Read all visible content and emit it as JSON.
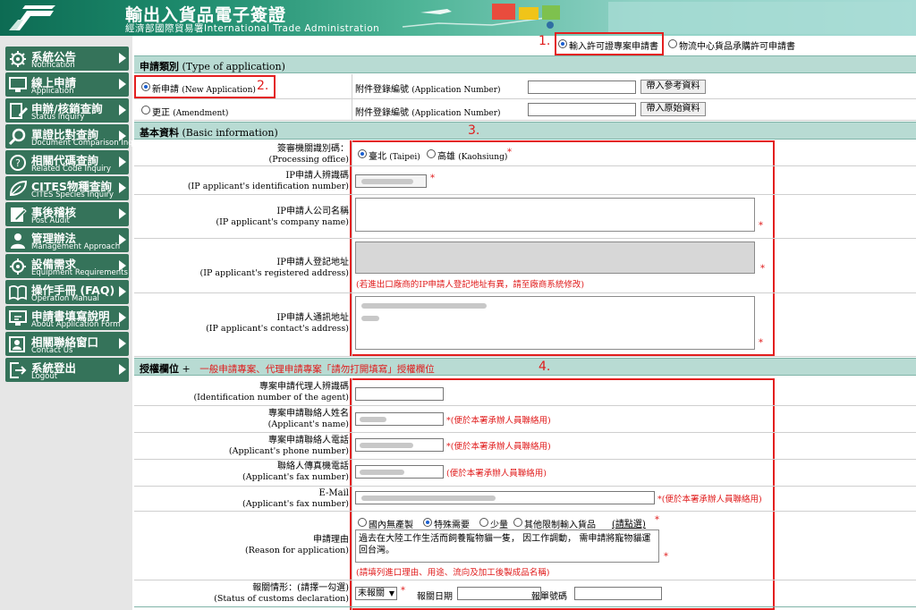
{
  "header": {
    "title": "輸出入貨品電子簽證",
    "agency": "經濟部國際貿易署International Trade Administration"
  },
  "sidebar": {
    "items": [
      {
        "zh": "系統公告",
        "en": "Notification",
        "icon": "settings-gear-icon"
      },
      {
        "zh": "線上申請",
        "en": "Application",
        "icon": "monitor-icon"
      },
      {
        "zh": "申辦/核銷查詢",
        "en": "Status Inquiry",
        "icon": "edit-document-icon"
      },
      {
        "zh": "單證比對查詢",
        "en": "Document Comparison Inquiry",
        "icon": "magnifier-icon"
      },
      {
        "zh": "相關代碼查詢",
        "en": "Related Code Inquiry",
        "icon": "question-icon"
      },
      {
        "zh": "CITES物種查詢",
        "en": "CITES Species Inquiry",
        "icon": "leaf-icon"
      },
      {
        "zh": "事後稽核",
        "en": "Post Audit",
        "icon": "pencil-icon"
      },
      {
        "zh": "管理辦法",
        "en": "Management Approach",
        "icon": "person-icon"
      },
      {
        "zh": "設備需求",
        "en": "Equipment Requirements",
        "icon": "settings-gear-icon"
      },
      {
        "zh": "操作手冊 (FAQ)",
        "en": "Operation Manual",
        "icon": "book-icon"
      },
      {
        "zh": "申請書填寫說明",
        "en": "About Application Form",
        "icon": "monitor-icon"
      },
      {
        "zh": "相關聯絡窗口",
        "en": "Contact Us",
        "icon": "contacts-icon"
      },
      {
        "zh": "系統登出",
        "en": "Logout",
        "icon": "logout-icon"
      }
    ]
  },
  "annotations": {
    "a1": "1.",
    "a2": "2.",
    "a3": "3.",
    "a4": "4."
  },
  "form_type": {
    "opt1": "輸入許可證專案申請書",
    "opt2": "物流中心貨品承購許可申請書"
  },
  "app_type": {
    "section": "申請類別",
    "section_en": "(Type of application)",
    "new_zh": "新申請",
    "new_en": "(New Application)",
    "amend_zh": "更正",
    "amend_en": "(Amendment)",
    "attach_label": "附件登錄編號",
    "attach_en": "(Application Number)",
    "btn_ref": "帶入參考資料",
    "btn_orig": "帶入原始資料"
  },
  "basic": {
    "section": "基本資料",
    "section_en": "(Basic information)",
    "office_zh": "簽審機關識別碼：",
    "office_en": "(Processing office)",
    "taipei": "臺北",
    "taipei_en": "(Taipei)",
    "kaohsiung": "高雄",
    "kaohsiung_en": "(Kaohsiung)",
    "idnum_zh": "IP申請人辨識碼",
    "idnum_en": "(IP applicant's identification number)",
    "company_zh": "IP申請人公司名稱",
    "company_en": "(IP applicant's company name)",
    "reg_zh": "IP申請人登記地址",
    "reg_en": "(IP applicant's registered address)",
    "reg_note": "(若進出口廠商的IP申請人登記地址有異，請至廠商系統修改)",
    "contact_zh": "IP申請人通訊地址",
    "contact_en": "(IP applicant's contact's address)"
  },
  "auth": {
    "section": "授權欄位",
    "plus": "+",
    "section_note": "一般申請專案、代理申請專案「請勿打開填寫」授權欄位",
    "agent_zh": "專案申請代理人辨識碼",
    "agent_en": "(Identification number of the agent)",
    "name_zh": "專案申請聯絡人姓名",
    "name_en": "(Applicant's name)",
    "phone_zh": "專案申請聯絡人電話",
    "phone_en": "(Applicant's phone number)",
    "fax_zh": "聯絡人傳真機電話",
    "fax_en": "(Applicant's fax number)",
    "email_zh": "E-Mail",
    "email_en": "(Applicant's fax number)",
    "contact_note": "(便於本署承辦人員聯絡用)",
    "reason_zh": "申請理由",
    "reason_en": "(Reason for application)",
    "r1": "國內無產製",
    "r2": "特殊需要",
    "r3": "少量",
    "r4": "其他限制輸入貨品",
    "pick": "(請點選)",
    "reason_text": "過去在大陸工作生活而飼養寵物貓一隻， 因工作調動， 需申請將寵物貓運回台灣。",
    "reason_note": "(請填列進口理由、用途、流向及加工後製成品名稱)",
    "customs_zh": "報關情形：(請擇一勾選)",
    "customs_en": "(Status of customs declaration)",
    "customs_value": "未報關",
    "customs_date": "報關日期",
    "customs_no": "報單號碼"
  },
  "required_mark": "*"
}
